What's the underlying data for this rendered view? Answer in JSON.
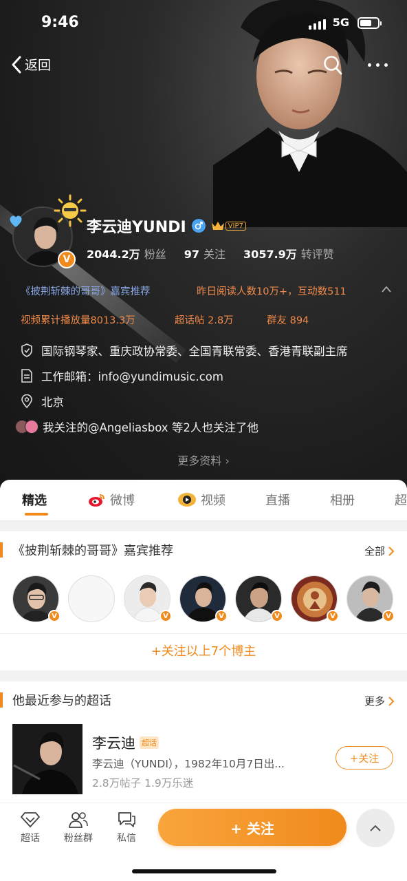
{
  "status_bar": {
    "time": "9:46",
    "network": "5G"
  },
  "nav": {
    "back_label": "返回"
  },
  "profile": {
    "name": "李云迪YUNDI",
    "vip_label": "VIP7",
    "stats": [
      {
        "value": "2044.2万",
        "label": "粉丝"
      },
      {
        "value": "97",
        "label": "关注"
      },
      {
        "value": "3057.9万",
        "label": "转评赞"
      }
    ],
    "recommend_text": "《披荆斩棘的哥哥》嘉宾推荐",
    "reading_text": "昨日阅读人数10万+，互动数511",
    "video_plays": "视频累计播放量8013.3万",
    "super_posts": "超话帖 2.8万",
    "group_friends": "群友 894",
    "info": {
      "title": "国际钢琴家、重庆政协常委、全国青联常委、香港青联副主席",
      "email": "工作邮箱：info@yundimusic.com",
      "location": "北京",
      "mutual": "我关注的@Angeliasbox 等2人也关注了他"
    },
    "more_info": "更多资料 ›"
  },
  "tabs": [
    {
      "label": "精选",
      "icon": ""
    },
    {
      "label": "微博",
      "icon": "weibo-icon"
    },
    {
      "label": "视频",
      "icon": "video-icon"
    },
    {
      "label": "直播",
      "icon": ""
    },
    {
      "label": "相册",
      "icon": ""
    },
    {
      "label": "超",
      "icon": ""
    }
  ],
  "guests_section": {
    "title": "《披荆斩棘的哥哥》嘉宾推荐",
    "link": "全部",
    "follow_all": "+关注以上7个博主"
  },
  "topic_section": {
    "title": "他最近参与的超话",
    "link": "更多",
    "topic_name": "李云迪",
    "tag": "超话",
    "desc": "李云迪（YUNDI），1982年10月7日出...",
    "stats": "2.8万帖子 1.9万乐迷",
    "follow_label": "+关注"
  },
  "bottom_bar": {
    "items": [
      {
        "label": "超话",
        "icon": "super-topic-icon"
      },
      {
        "label": "粉丝群",
        "icon": "fan-group-icon"
      },
      {
        "label": "私信",
        "icon": "message-icon"
      }
    ],
    "follow_label": "+ 关注"
  },
  "colors": {
    "accent": "#f08a1c",
    "link_blue": "#8aa8e6",
    "hero_bg": "#1c1c1c"
  }
}
